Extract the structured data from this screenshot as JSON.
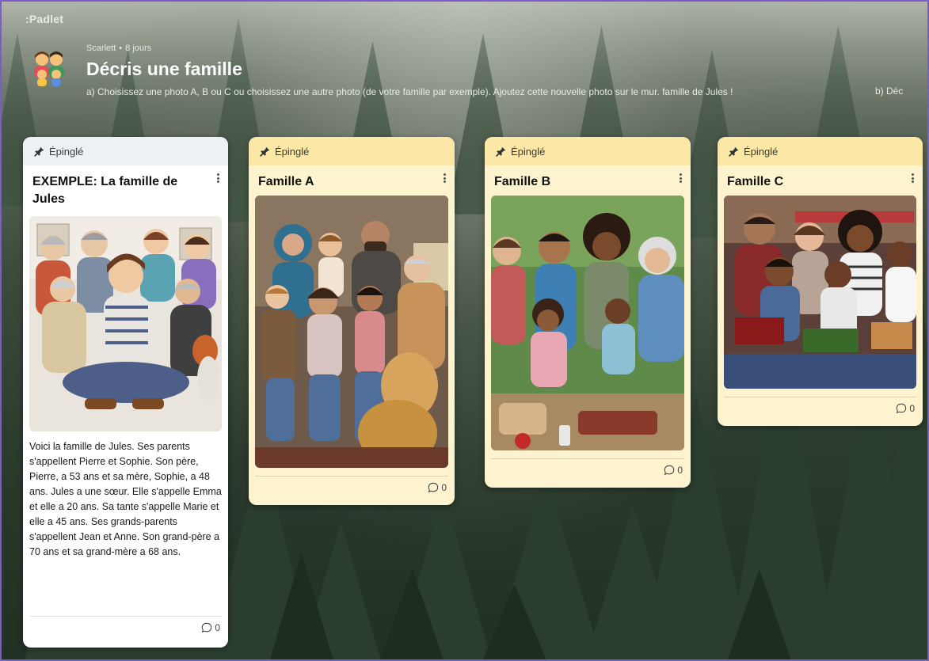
{
  "brand": ":Padlet",
  "header": {
    "author": "Scarlett",
    "separator": "•",
    "time": "8 jours",
    "title": "Décris une famille",
    "description": "a) Choisissez une photo A, B ou C ou choisissez une autre photo (de votre famille par exemple). Ajoutez cette nouvelle photo sur le mur. famille de Jules !",
    "description_cont": "b) Déc"
  },
  "pinned_label": "Épinglé",
  "cards": [
    {
      "title": "EXEMPLE: La famille de Jules",
      "image_alt": "Illustrated family of Jules",
      "body": "Voici la famille de Jules. Ses parents s'appellent Pierre et Sophie. Son père, Pierre, a 53 ans et sa mère, Sophie, a 48 ans. Jules a une sœur. Elle s'appelle Emma et elle a 20 ans. Sa tante s'appelle Marie et elle a 45 ans. Ses grands-parents s'appellent Jean et Anne. Son grand-père a 70 ans et sa grand-mère a 68 ans.",
      "comments": "0"
    },
    {
      "title": "Famille A",
      "comments": "0"
    },
    {
      "title": "Famille B",
      "comments": "0"
    },
    {
      "title": "Famille C",
      "comments": "0"
    }
  ],
  "colors": {
    "border_accent": "#7b5cc9",
    "card_white": "#ffffff",
    "card_yellow": "#fdf4cf",
    "pin_bar_yellow": "#fbe7a6",
    "pin_bar_gray": "#eef1f4"
  }
}
